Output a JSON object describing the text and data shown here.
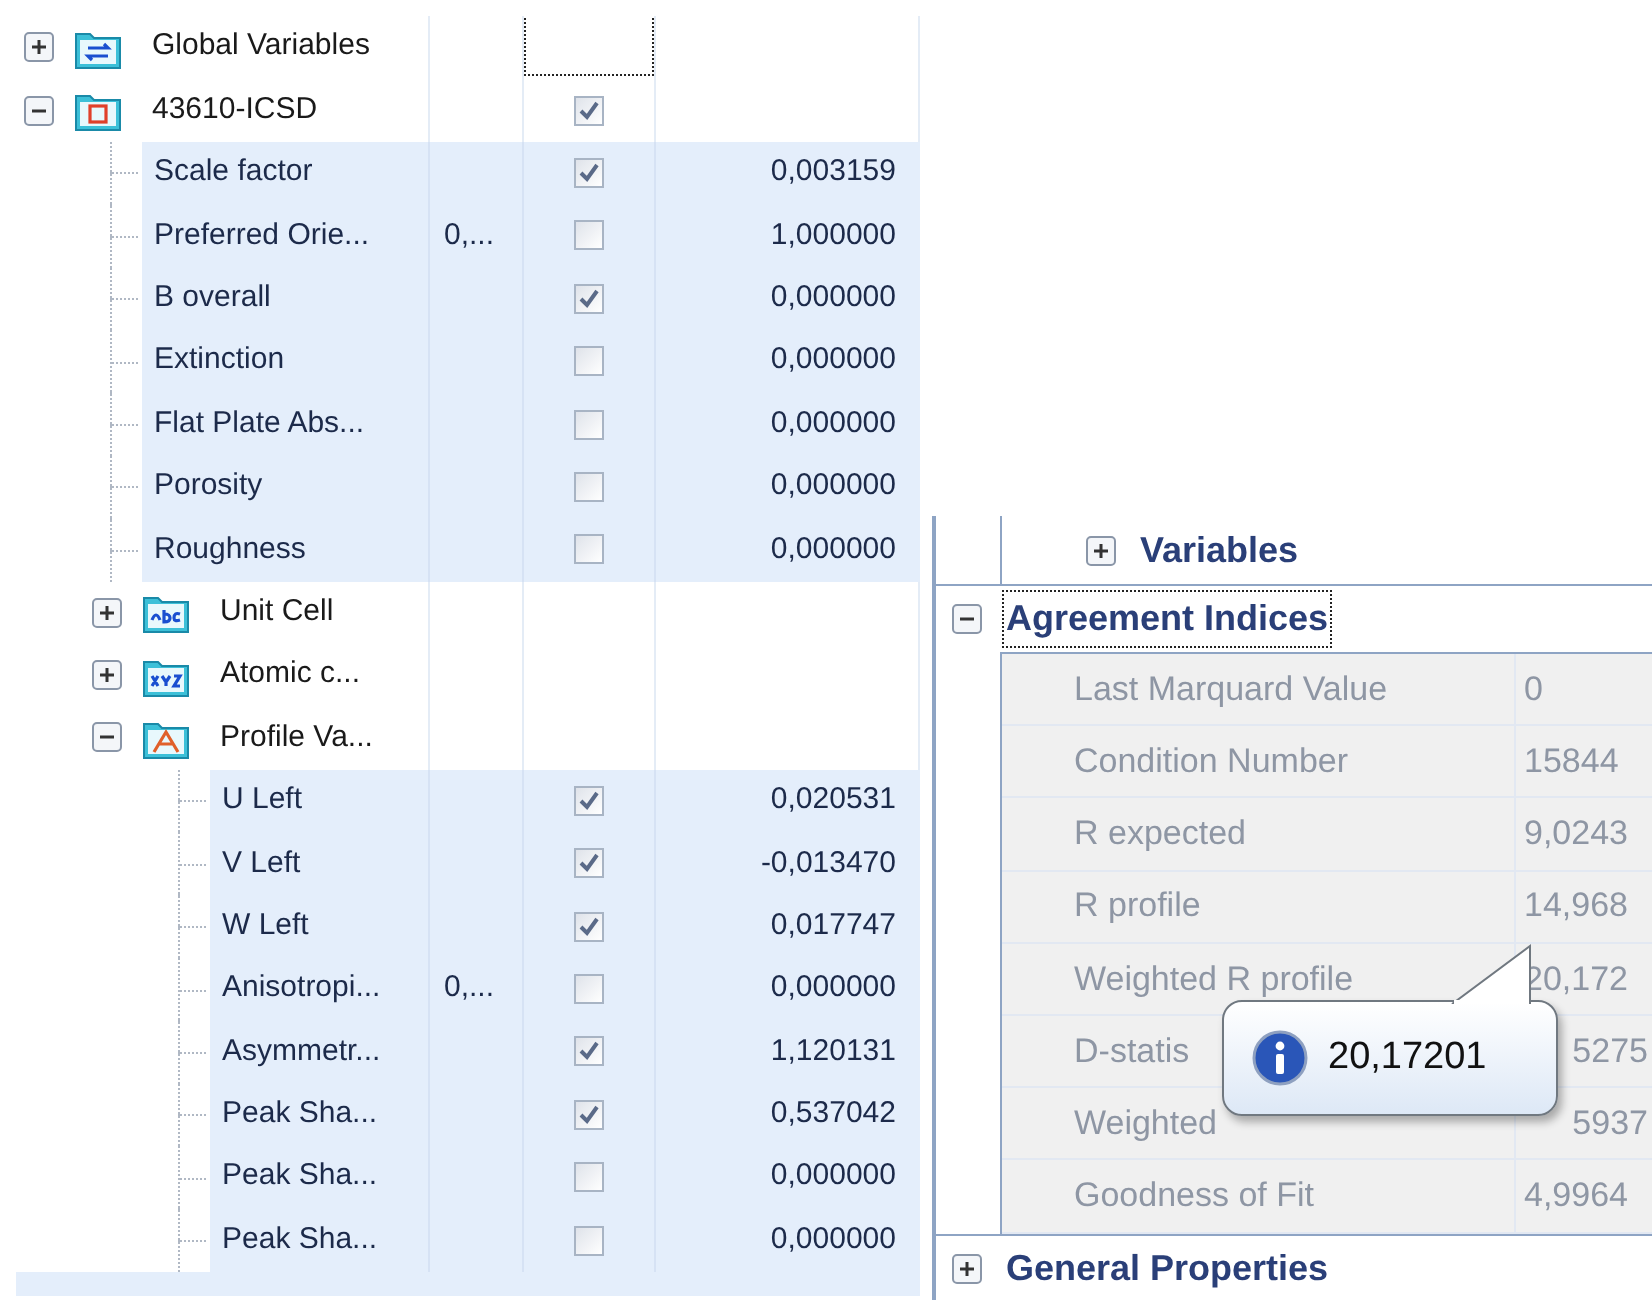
{
  "tree": [
    {
      "kind": "group",
      "label": "Global Variables",
      "expanded": false,
      "focused": true
    },
    {
      "kind": "group",
      "label": "43610-ICSD",
      "expanded": true,
      "checked": true,
      "children": [
        {
          "kind": "param",
          "label": "Scale factor",
          "checked": true,
          "value": "0,003159"
        },
        {
          "kind": "param",
          "label": "Preferred Orie...",
          "extra": "0,...",
          "checked": false,
          "value": "1,000000"
        },
        {
          "kind": "param",
          "label": "B overall",
          "checked": true,
          "value": "0,000000"
        },
        {
          "kind": "param",
          "label": "Extinction",
          "checked": false,
          "value": "0,000000"
        },
        {
          "kind": "param",
          "label": "Flat Plate Abs...",
          "checked": false,
          "value": "0,000000"
        },
        {
          "kind": "param",
          "label": "Porosity",
          "checked": false,
          "value": "0,000000"
        },
        {
          "kind": "param",
          "label": "Roughness",
          "checked": false,
          "value": "0,000000"
        },
        {
          "kind": "group",
          "label": "Unit Cell",
          "expanded": false
        },
        {
          "kind": "group",
          "label": "Atomic c...",
          "expanded": false
        },
        {
          "kind": "group",
          "label": "Profile Va...",
          "expanded": true,
          "children": [
            {
              "kind": "param",
              "label": "U Left",
              "checked": true,
              "value": "0,020531"
            },
            {
              "kind": "param",
              "label": "V Left",
              "checked": true,
              "value": "-0,013470"
            },
            {
              "kind": "param",
              "label": "W Left",
              "checked": true,
              "value": "0,017747"
            },
            {
              "kind": "param",
              "label": "Anisotropi...",
              "extra": "0,...",
              "checked": false,
              "value": "0,000000"
            },
            {
              "kind": "param",
              "label": "Asymmetr...",
              "checked": true,
              "value": "1,120131"
            },
            {
              "kind": "param",
              "label": "Peak Sha...",
              "checked": true,
              "value": "0,537042"
            },
            {
              "kind": "param",
              "label": "Peak Sha...",
              "checked": false,
              "value": "0,000000"
            },
            {
              "kind": "param",
              "label": "Peak Sha...",
              "checked": false,
              "value": "0,000000"
            }
          ]
        }
      ]
    }
  ],
  "properties": [
    {
      "kind": "subsection",
      "title": "Variables",
      "expanded": false,
      "focused": false
    },
    {
      "kind": "section",
      "title": "Agreement Indices",
      "expanded": true,
      "focused": true,
      "rows": [
        {
          "label": "Last Marquard Value",
          "value": "0",
          "disabled": true
        },
        {
          "label": "Condition Number",
          "value": "15844",
          "disabled": true
        },
        {
          "label": "R expected",
          "value": "9,0243",
          "disabled": true
        },
        {
          "label": "R profile",
          "value": "14,968",
          "disabled": true
        },
        {
          "label": "Weighted R profile",
          "value": "20,172",
          "disabled": true
        },
        {
          "label": "D-statis",
          "value": "5275",
          "disabled": true,
          "covered": true
        },
        {
          "label": "Weighted",
          "value": "5937",
          "disabled": true,
          "covered": true
        },
        {
          "label": "Goodness of Fit",
          "value": "4,9964",
          "disabled": true
        }
      ]
    },
    {
      "kind": "section",
      "title": "General Properties",
      "expanded": false,
      "focused": false
    }
  ],
  "tooltip": {
    "text": "20,17201"
  }
}
